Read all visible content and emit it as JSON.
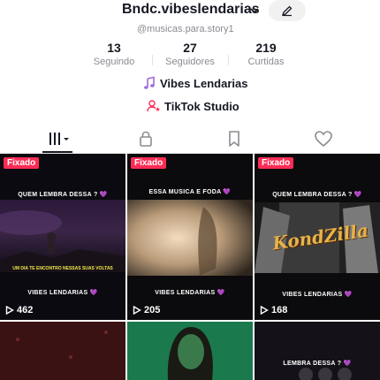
{
  "profile": {
    "username": "Bndc.vibeslendarias",
    "handle": "@musicas.para.story1",
    "stats": [
      {
        "value": "13",
        "label": "Seguindo"
      },
      {
        "value": "27",
        "label": "Seguidores"
      },
      {
        "value": "219",
        "label": "Curtidas"
      }
    ],
    "playlist_label": "Vibes Lendarias",
    "studio_label": "TikTok Studio"
  },
  "tabs": [
    "videos-grid-icon",
    "lock-icon",
    "bookmark-icon",
    "heart-icon"
  ],
  "colors": {
    "accent": "#fe2c55",
    "playlist": "#9d6bd6",
    "text": "#161823",
    "muted": "#8a8b91"
  },
  "videos": [
    {
      "pinned": "Fixado",
      "top_caption": "QUEM LEMBRA DESSA ? 💜",
      "mid_caption": "UM DIA TE ENCONTRO NESSAS SUAS VOLTAS",
      "bottom_caption": "VIBES LENDARIAS 💜",
      "views": "462"
    },
    {
      "pinned": "Fixado",
      "top_caption": "ESSA MUSICA E FODA 💜",
      "mid_caption": "",
      "bottom_caption": "VIBES LENDARIAS 💜",
      "views": "205"
    },
    {
      "pinned": "Fixado",
      "top_caption": "QUEM LEMBRA DESSA ? 💜",
      "logo": "KondZilla",
      "bottom_caption": "VIBES LENDARIAS 💜",
      "views": "168"
    },
    {
      "top_caption": ""
    },
    {
      "top_caption": ""
    },
    {
      "top_caption": "LEMBRA DESSA ? 💜"
    }
  ]
}
